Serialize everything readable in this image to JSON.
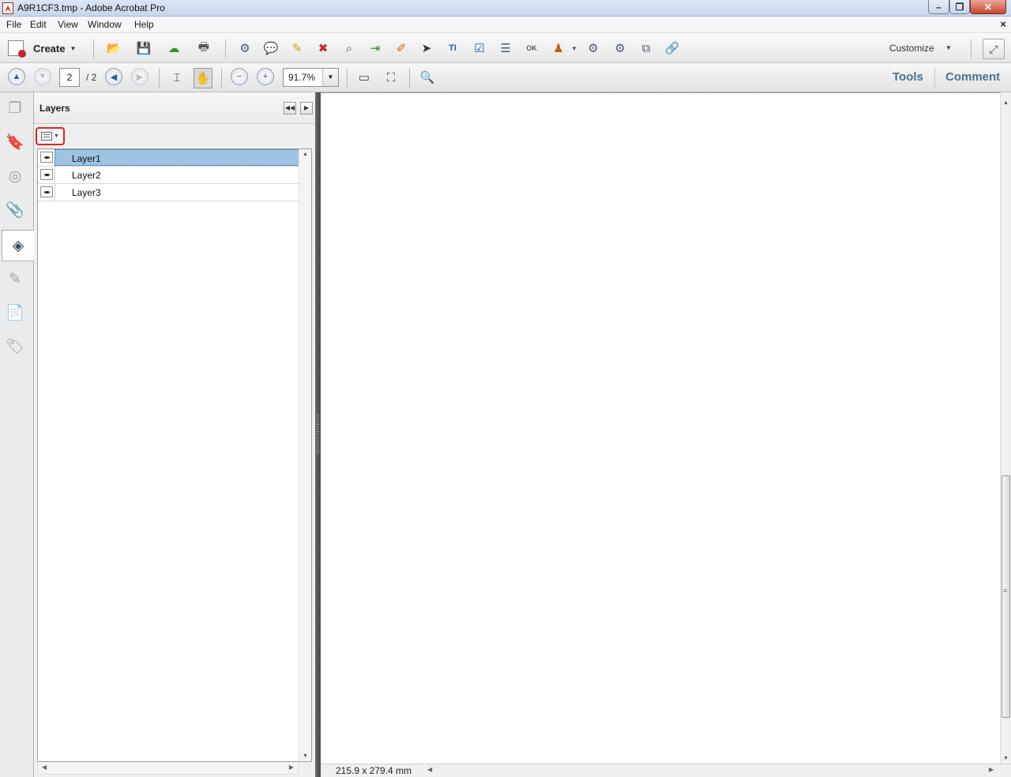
{
  "window": {
    "title": "A9R1CF3.tmp - Adobe Acrobat Pro",
    "min_glyph": "–",
    "max_glyph": "❐",
    "close_glyph": "✕"
  },
  "menu": {
    "items": [
      "File",
      "Edit",
      "View",
      "Window",
      "Help"
    ],
    "doc_close": "×"
  },
  "toolbar": {
    "create_label": "Create",
    "customize_label": "Customize"
  },
  "nav": {
    "page_current": "2",
    "page_total": "/ 2",
    "zoom": "91.7%",
    "tabs": {
      "tools": "Tools",
      "comment": "Comment"
    }
  },
  "sidebar": {
    "icons": [
      "page-thumbnails-icon",
      "bookmarks-icon",
      "signatures-icon",
      "attachments-icon",
      "layers-icon",
      "content-icon",
      "articles-icon",
      "tags-icon"
    ],
    "active": "layers-icon"
  },
  "layers_panel": {
    "title": "Layers",
    "layers": [
      {
        "name": "Layer1",
        "selected": true
      },
      {
        "name": "Layer2",
        "selected": false
      },
      {
        "name": "Layer3",
        "selected": false
      }
    ]
  },
  "status": {
    "page_size": "215.9 x 279.4 mm"
  },
  "colors": {
    "selection": "#9ec3e4",
    "highlight_border": "#e0261e",
    "tab_text": "#4d6f95"
  }
}
